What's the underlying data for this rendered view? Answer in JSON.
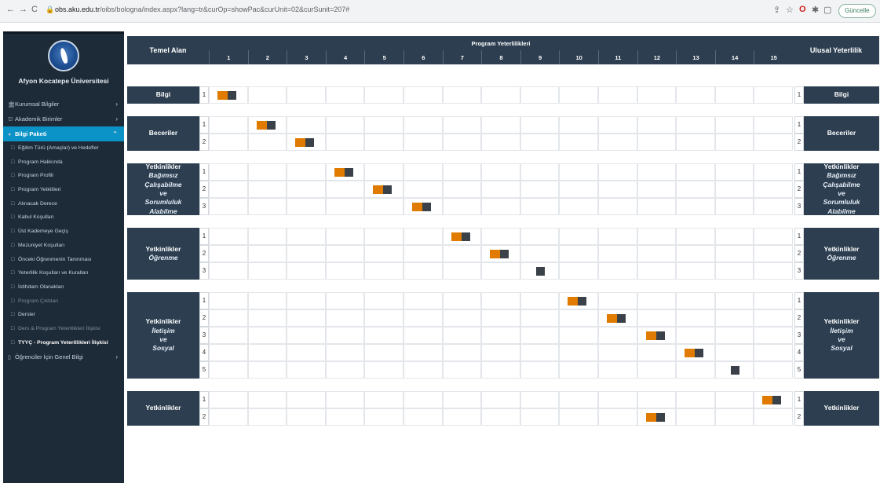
{
  "browser": {
    "back": "←",
    "forward": "→",
    "reload": "C",
    "url_host": "obs.aku.edu.tr",
    "url_path": "/oibs/bologna/index.aspx?lang=tr&curOp=showPac&curUnit=02&curSunit=207#",
    "update_label": "Güncelle"
  },
  "sidebar": {
    "university": "Afyon Kocatepe Üniversitesi",
    "items": [
      {
        "label": "Kurumsal Bilgiler",
        "icon": "🏛"
      },
      {
        "label": "Akademik Birimler",
        "icon": "⛫"
      },
      {
        "label": "Bilgi Paketi",
        "icon": "●"
      },
      {
        "label": "Eğitim Türü (Amaçlar) ve Hedefler"
      },
      {
        "label": "Program Hakkında"
      },
      {
        "label": "Program Profili"
      },
      {
        "label": "Program Yetkilileri"
      },
      {
        "label": "Alınacak Derece"
      },
      {
        "label": "Kabul Koşulları"
      },
      {
        "label": "Üst Kademeye Geçiş"
      },
      {
        "label": "Mezuniyet Koşulları"
      },
      {
        "label": "Önceki Öğrenmenin Tanınması"
      },
      {
        "label": "Yeterlilik Koşulları ve Kuralları"
      },
      {
        "label": "İstihdam Olanakları"
      },
      {
        "label": "Program Çıktıları"
      },
      {
        "label": "Dersler"
      },
      {
        "label": "Ders & Program Yeterlilikleri İlişkisi"
      },
      {
        "label": "TYYÇ - Program Yeterlilikleri İlişkisi"
      },
      {
        "label": "Öğrenciler İçin Genel Bilgi",
        "icon": "▯"
      }
    ]
  },
  "table": {
    "left_header": "Temel Alan",
    "center_header": "Program Yeterlilikleri",
    "right_header": "Ulusal Yeterlilik",
    "columns": [
      "1",
      "2",
      "3",
      "4",
      "5",
      "6",
      "7",
      "8",
      "9",
      "10",
      "11",
      "12",
      "13",
      "14",
      "15"
    ],
    "groups": [
      {
        "title": "Bilgi",
        "sub": [],
        "rows": [
          "1"
        ],
        "marks": [
          [
            0
          ]
        ]
      },
      {
        "title": "Beceriler",
        "sub": [],
        "rows": [
          "1",
          "2"
        ],
        "marks": [
          [
            1
          ],
          [
            2
          ]
        ]
      },
      {
        "title": "Yetkinlikler",
        "sub": [
          "Bağımsız",
          "Çalışabilme",
          "ve",
          "Sorumluluk",
          "Alabilme"
        ],
        "rows": [
          "1",
          "2",
          "3"
        ],
        "marks": [
          [
            3
          ],
          [
            4
          ],
          [
            5
          ]
        ]
      },
      {
        "title": "Yetkinlikler",
        "sub": [
          "Öğrenme"
        ],
        "rows": [
          "1",
          "2",
          "3"
        ],
        "marks": [
          [
            6
          ],
          [
            7
          ],
          [
            8
          ]
        ]
      },
      {
        "title": "Yetkinlikler",
        "sub": [
          "İletişim",
          "ve",
          "Sosyal"
        ],
        "rows": [
          "1",
          "2",
          "3",
          "4",
          "5"
        ],
        "marks": [
          [
            9
          ],
          [
            10
          ],
          [
            11
          ],
          [
            12
          ],
          [
            13
          ]
        ]
      },
      {
        "title": "Yetkinlikler",
        "sub": [],
        "rows": [
          "1",
          "2"
        ],
        "marks": [
          [
            14
          ],
          [
            11
          ]
        ]
      }
    ],
    "mark_styles": {
      "full": "orange+dark",
      "dark_only_cols": [
        8,
        13
      ]
    },
    "colors": {
      "header": "#2c3e50",
      "orange": "#e07b00",
      "dark": "#3b4148",
      "accent": "#0b93c7"
    }
  }
}
